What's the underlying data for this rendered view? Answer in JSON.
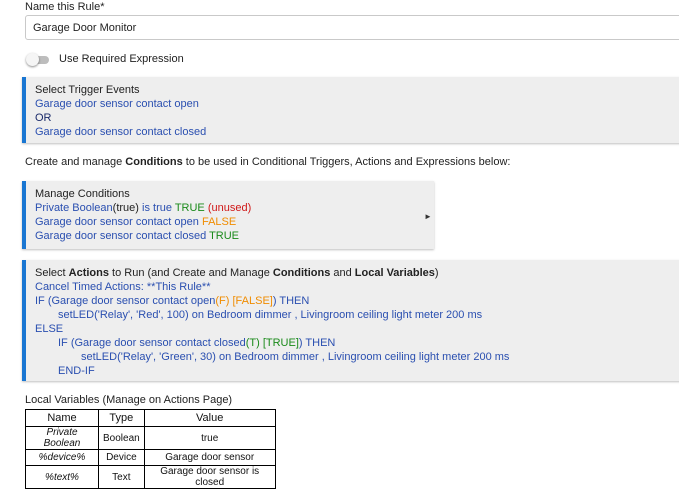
{
  "rule_name": {
    "label": "Name this Rule*",
    "value": "Garage Door Monitor"
  },
  "required_expression": {
    "label": "Use Required Expression",
    "enabled": false
  },
  "trigger_events": {
    "title": "Select Trigger Events",
    "event_1": "Garage door sensor contact open",
    "or": "OR",
    "event_2": "Garage door sensor contact closed"
  },
  "conditions_helper": {
    "prefix": "Create and manage ",
    "bold": "Conditions",
    "suffix": " to be used in Conditional Triggers, Actions and Expressions below:"
  },
  "manage_conditions": {
    "title": "Manage Conditions",
    "items": [
      {
        "text": "Private Boolean",
        "arg": "(true)",
        "text2": " is true ",
        "state": "TRUE",
        "note": "(unused)"
      },
      {
        "text": "Garage door sensor contact open ",
        "state": "FALSE"
      },
      {
        "text": "Garage door sensor contact closed ",
        "state": "TRUE"
      }
    ],
    "arrow": "►"
  },
  "actions": {
    "title_1": "Select ",
    "title_b1": "Actions",
    "title_2": " to Run (and Create and Manage ",
    "title_b2": "Conditions",
    "title_3": " and ",
    "title_b3": "Local Variables",
    "title_4": ")",
    "cancel": "Cancel Timed Actions: **This Rule**",
    "if_1": "IF (Garage door sensor contact open",
    "if_1_flag": "(F)",
    "if_1_state": "[FALSE]",
    "if_1_end": ") THEN",
    "led_1": "setLED('Relay', 'Red', 100) on Bedroom dimmer , Livingroom ceiling light meter 200 ms",
    "else": "ELSE",
    "if_2": "IF (Garage door sensor contact closed",
    "if_2_flag": "(T)",
    "if_2_state": "[TRUE]",
    "if_2_end": ") THEN",
    "led_2": "setLED('Relay', 'Green', 30) on Bedroom dimmer , Livingroom ceiling light meter 200 ms",
    "end_if": "END-IF"
  },
  "local_variables": {
    "title": "Local Variables",
    "subtitle": " (Manage on Actions Page)",
    "columns": [
      "Name",
      "Type",
      "Value"
    ],
    "rows": [
      [
        "Private Boolean",
        "Boolean",
        "true"
      ],
      [
        "%device%",
        "Device",
        "Garage door sensor"
      ],
      [
        "%text%",
        "Text",
        "Garage door sensor is closed"
      ]
    ]
  },
  "colors": {
    "accent": "#1976d2",
    "link": "#2a4fb0",
    "true": "#1a8a1a",
    "false": "#f08c00",
    "unused": "#d01818"
  }
}
